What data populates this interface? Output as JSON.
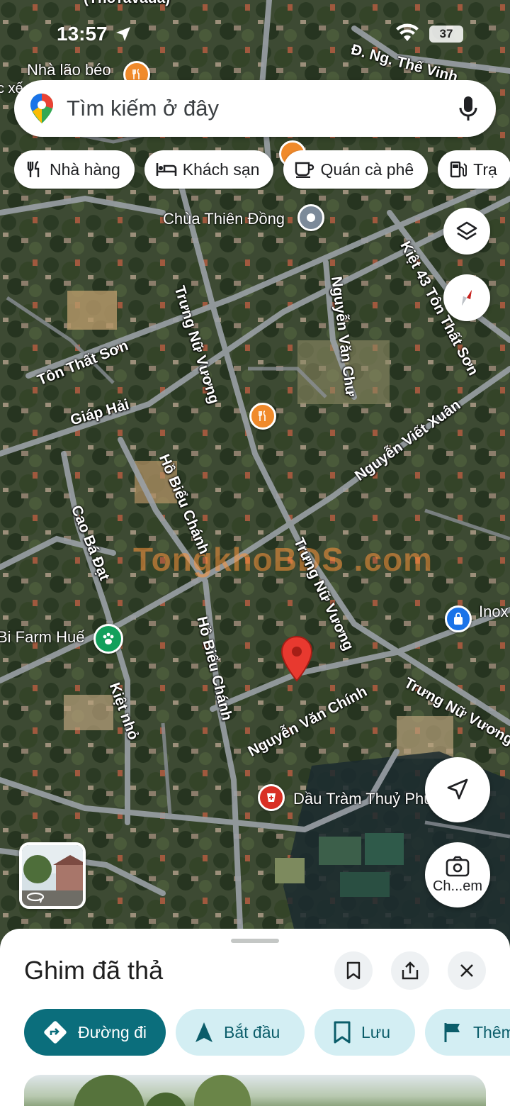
{
  "status_bar": {
    "time": "13:57",
    "battery": "37"
  },
  "search": {
    "placeholder": "Tìm kiếm ở đây"
  },
  "chips": [
    {
      "label": "Nhà hàng",
      "icon": "fork-knife-icon"
    },
    {
      "label": "Khách sạn",
      "icon": "bed-icon"
    },
    {
      "label": "Quán cà phê",
      "icon": "coffee-icon"
    },
    {
      "label": "Trạ",
      "icon": "gas-station-icon"
    }
  ],
  "map": {
    "top_partial_label": "(Thơravada)",
    "road_labels": [
      "Đ. Ng. Thế Vinh",
      "Kiệt 43 Tôn Thất Sơn",
      "Trưng Nữ Vương",
      "Nguyễn Văn Chư",
      "Tôn Thất Sơn",
      "Giáp Hải",
      "Nguyễn Viết Xuân",
      "Hồ Biểu Chánh",
      "Cao Bá Đạt",
      "Trưng Nữ Vương",
      "Hồ Biểu Chánh",
      "Kiệt nhỏ",
      "Nguyễn Văn Chính",
      "Trưng Nữ Vương"
    ],
    "places": [
      {
        "name": "Nhà lão béo",
        "icon": "restaurant-icon",
        "color": "#f08a2b"
      },
      {
        "name": "Chùa Thiên Đồng",
        "icon": "place-icon",
        "color": "#7c8a99"
      },
      {
        "name": "Bi Farm Huế",
        "icon": "paw-icon",
        "color": "#12a05c"
      },
      {
        "name": "Inox Hiếu",
        "icon": "shopping-icon",
        "color": "#1a73e8"
      },
      {
        "name": "Dầu Tràm Thuỷ Phương",
        "icon": "pharmacy-icon",
        "color": "#d93025"
      }
    ],
    "left_edge_fragment": "c xế",
    "watermark": "TongkhoBDS .com",
    "dropped_pin_color": "#e8392f"
  },
  "fab": {
    "lens_label": "Ch...em"
  },
  "sheet": {
    "title": "Ghim đã thả",
    "actions": [
      {
        "label": "Đường đi",
        "icon": "directions-icon"
      },
      {
        "label": "Bắt đầu",
        "icon": "navigation-arrow-icon"
      },
      {
        "label": "Lưu",
        "icon": "bookmark-icon"
      },
      {
        "label": "Thêm",
        "icon": "flag-icon"
      }
    ]
  }
}
